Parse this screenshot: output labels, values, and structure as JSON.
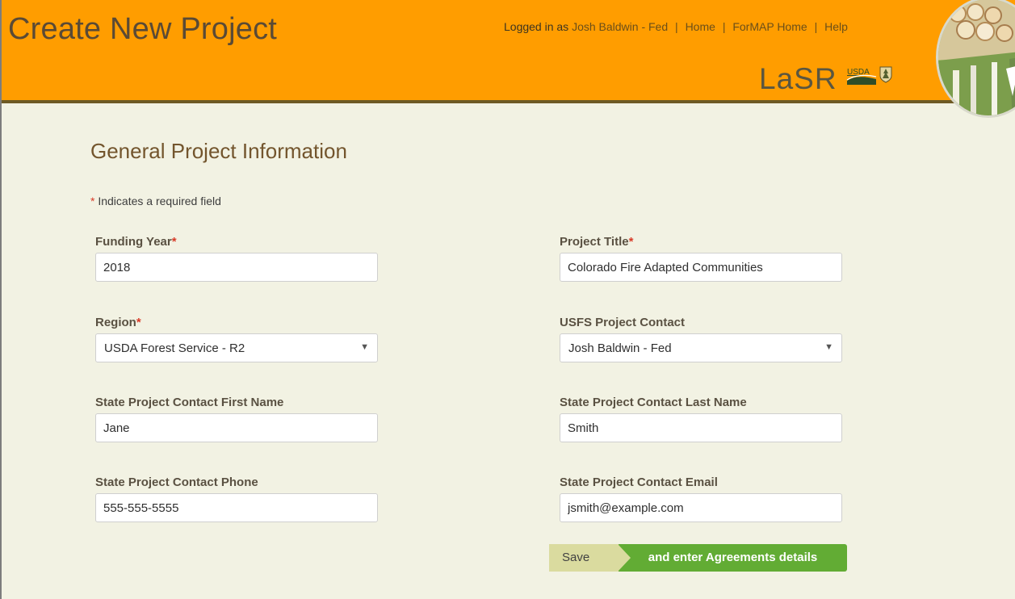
{
  "header": {
    "title": "Create New Project",
    "nav": {
      "logged_in_prefix": "Logged in as ",
      "user": "Josh Baldwin - Fed",
      "separator": "|",
      "links": [
        "Home",
        "ForMAP Home",
        "Help"
      ]
    },
    "brand": {
      "name": "LaSR",
      "usda": "USDA"
    }
  },
  "form": {
    "section_title": "General Project Information",
    "required_note_star": "*",
    "required_note_text": "Indicates a required field",
    "fields": {
      "funding_year": {
        "label": "Funding Year",
        "required": "*",
        "value": "2018"
      },
      "project_title": {
        "label": "Project Title",
        "required": "*",
        "value": "Colorado Fire Adapted Communities"
      },
      "region": {
        "label": "Region",
        "required": "*",
        "value": "USDA Forest Service - R2"
      },
      "usfs_contact": {
        "label": "USFS Project Contact",
        "value": "Josh Baldwin - Fed"
      },
      "state_first_name": {
        "label": "State Project Contact First Name",
        "value": "Jane"
      },
      "state_last_name": {
        "label": "State Project Contact Last Name",
        "value": "Smith"
      },
      "state_phone": {
        "label": "State Project Contact Phone",
        "value": "555-555-5555"
      },
      "state_email": {
        "label": "State Project Contact Email",
        "value": "jsmith@example.com"
      }
    },
    "buttons": {
      "save": "Save",
      "agreements": "and enter Agreements details"
    }
  },
  "colors": {
    "header_orange": "#ff9d00",
    "background": "#f2f2e3",
    "accent_green": "#62ac34",
    "required_red": "#d83b28"
  },
  "icons": [
    "dropdown-arrow-icon",
    "usda-logo-icon",
    "forest-service-shield-icon",
    "forest-photo-collage-icon"
  ]
}
